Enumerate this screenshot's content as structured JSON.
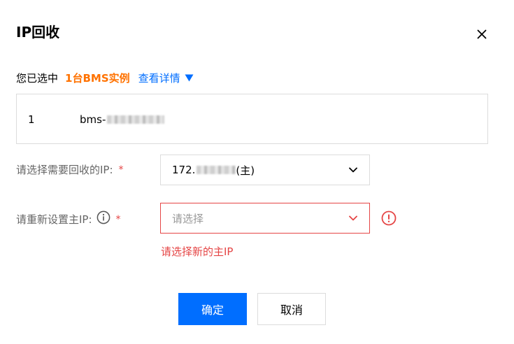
{
  "dialog": {
    "title": "IP回收",
    "close_icon": "close-icon"
  },
  "selection": {
    "prefix": "您已选中",
    "count_text": "1台BMS实例",
    "details_label": "查看详情",
    "details_icon": "caret-down-icon"
  },
  "instances": [
    {
      "index": "1",
      "name_prefix": "bms-"
    }
  ],
  "fields": {
    "recycle_ip": {
      "label": "请选择需要回收的IP:",
      "required_mark": "*",
      "value_prefix": "172.",
      "value_suffix": "(主)"
    },
    "new_primary_ip": {
      "label": "请重新设置主IP:",
      "required_mark": "*",
      "placeholder": "请选择",
      "error_message": "请选择新的主IP"
    }
  },
  "buttons": {
    "ok_label": "确定",
    "cancel_label": "取消"
  },
  "colors": {
    "accent": "#006eff",
    "highlight": "#ff7200",
    "error": "#e54545",
    "border": "#dcdcdc"
  }
}
